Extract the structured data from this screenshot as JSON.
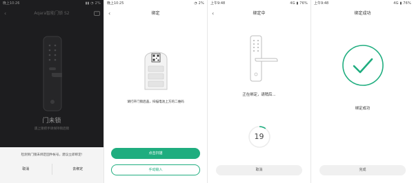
{
  "screen1": {
    "status_left": "晚上10:26",
    "status_right": "▮▮ ◔ 2%",
    "title": "Aqara智能门锁 S2",
    "state": "门未锁",
    "hint": "遇上锁把手请保持锁后锁",
    "dialog_message": "检测到门锁未绑定固件帐号，建议立即绑定!",
    "cancel_label": "取消",
    "bind_label": "去绑定"
  },
  "screen2": {
    "status_left": "晚上10:25",
    "status_right": "◔ 2%",
    "title": "绑定",
    "instruction": "请打开门锁后盖，扫描电池上方的二维码",
    "scan_label": "点击扫描",
    "manual_label": "手动输入"
  },
  "screen3": {
    "status_left": "上午9:48",
    "status_right": "4G ▮ 76%",
    "title": "绑定中",
    "message": "正在绑定，请稍后...",
    "countdown": "19",
    "countdown_progress": 0.1,
    "cancel_label": "取消"
  },
  "screen4": {
    "status_left": "上午9:48",
    "status_right": "4G ▮ 76%",
    "title": "绑定成功",
    "message": "绑定成功",
    "done_label": "完成"
  },
  "colors": {
    "accent": "#1fad7f",
    "dark_bg": "#1d1d1f"
  }
}
